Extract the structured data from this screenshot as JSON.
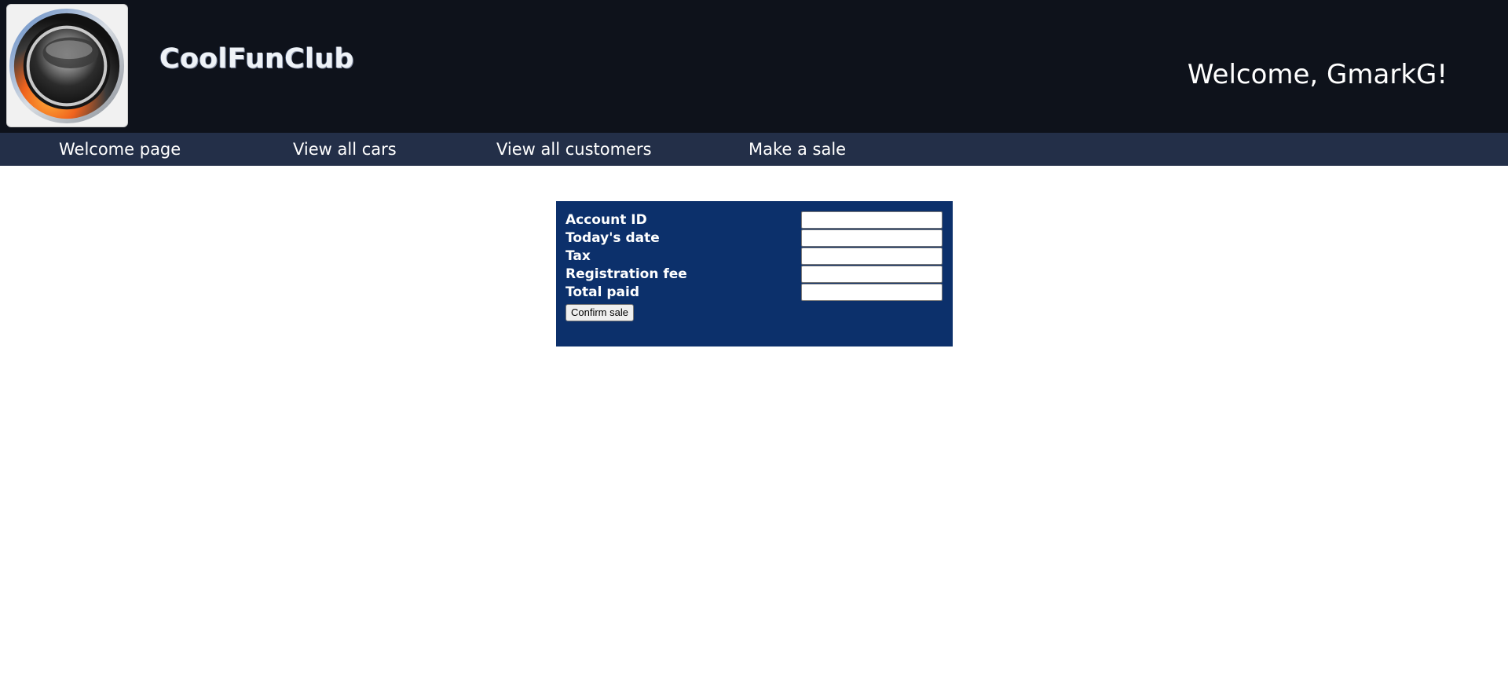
{
  "header": {
    "site_title": "CoolFunClub",
    "welcome_text": "Welcome, GmarkG!",
    "logo_icon": "orb-logo-icon"
  },
  "nav": {
    "items": [
      {
        "label": "Welcome page"
      },
      {
        "label": "View all cars"
      },
      {
        "label": "View all customers"
      },
      {
        "label": "Make a sale"
      }
    ]
  },
  "sale_form": {
    "fields": [
      {
        "label": "Account ID",
        "value": ""
      },
      {
        "label": "Today's date",
        "value": ""
      },
      {
        "label": "Tax",
        "value": ""
      },
      {
        "label": "Registration fee",
        "value": ""
      },
      {
        "label": "Total paid",
        "value": ""
      }
    ],
    "confirm_label": "Confirm sale"
  },
  "colors": {
    "header_bg": "#0e121b",
    "nav_bg": "#232f48",
    "panel_bg": "#0c306b",
    "page_bg": "#ffffff"
  }
}
